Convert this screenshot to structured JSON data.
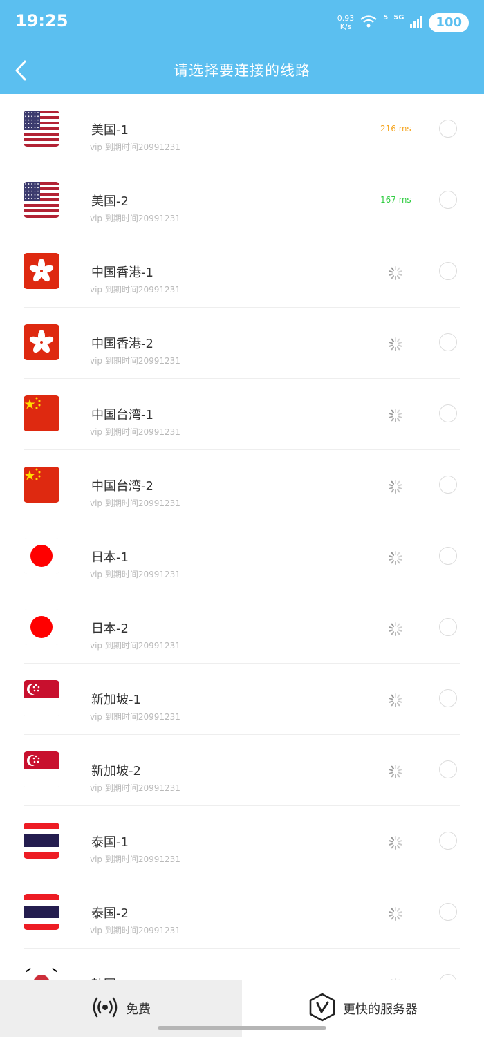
{
  "status_bar": {
    "time": "19:25",
    "net_speed_value": "0.93",
    "net_speed_unit": "K/s",
    "wifi_label": "5",
    "signal_label": "5G",
    "battery": "100"
  },
  "header": {
    "title": "请选择要连接的线路"
  },
  "servers": [
    {
      "name": "美国-1",
      "sub": "vip  到期时间20991231",
      "flag": "us",
      "ping": "216 ms",
      "ping_color": "#f5a623",
      "loading": false
    },
    {
      "name": "美国-2",
      "sub": "vip  到期时间20991231",
      "flag": "us",
      "ping": "167 ms",
      "ping_color": "#2ecc40",
      "loading": false
    },
    {
      "name": "中国香港-1",
      "sub": "vip  到期时间20991231",
      "flag": "hk",
      "ping": "",
      "loading": true
    },
    {
      "name": "中国香港-2",
      "sub": "vip  到期时间20991231",
      "flag": "hk",
      "ping": "",
      "loading": true
    },
    {
      "name": "中国台湾-1",
      "sub": "vip  到期时间20991231",
      "flag": "cn",
      "ping": "",
      "loading": true
    },
    {
      "name": "中国台湾-2",
      "sub": "vip  到期时间20991231",
      "flag": "cn",
      "ping": "",
      "loading": true
    },
    {
      "name": "日本-1",
      "sub": "vip  到期时间20991231",
      "flag": "jp",
      "ping": "",
      "loading": true
    },
    {
      "name": "日本-2",
      "sub": "vip  到期时间20991231",
      "flag": "jp",
      "ping": "",
      "loading": true
    },
    {
      "name": "新加坡-1",
      "sub": "vip  到期时间20991231",
      "flag": "sg",
      "ping": "",
      "loading": true
    },
    {
      "name": "新加坡-2",
      "sub": "vip  到期时间20991231",
      "flag": "sg",
      "ping": "",
      "loading": true
    },
    {
      "name": "泰国-1",
      "sub": "vip  到期时间20991231",
      "flag": "th",
      "ping": "",
      "loading": true
    },
    {
      "name": "泰国-2",
      "sub": "vip  到期时间20991231",
      "flag": "th",
      "ping": "",
      "loading": true
    },
    {
      "name": "韩国",
      "sub": "",
      "flag": "kr",
      "ping": "",
      "loading": true
    }
  ],
  "bottom_tabs": {
    "free_label": "免费",
    "free_icon": "broadcast-icon",
    "fast_label": "更快的服务器",
    "fast_icon": "v-shield-icon"
  },
  "colors": {
    "header_bg": "#5bbff0",
    "ping_slow": "#f5a623",
    "ping_fast": "#2ecc40"
  }
}
